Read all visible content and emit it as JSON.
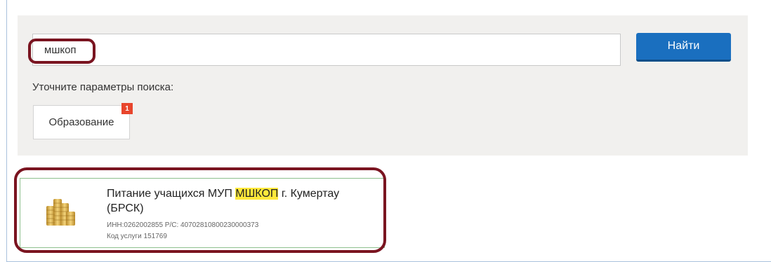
{
  "search": {
    "value": "мшкоп",
    "button_label": "Найти"
  },
  "filters": {
    "refine_label": "Уточните параметры поиска:",
    "category_label": "Образование",
    "category_count": "1"
  },
  "result": {
    "title_before": "Питание учащихся МУП ",
    "title_highlight": "МШКОП",
    "title_after": " г. Кумертау (БРСК)",
    "details": "ИНН:0262002855 Р/С: 40702810800230000373",
    "service_code": "Код услуги 151769",
    "icon": "coins-icon"
  },
  "colors": {
    "accent": "#1a6fbf",
    "badge": "#e8452c",
    "highlight": "#ffe93b",
    "annotation": "#7a1420"
  }
}
